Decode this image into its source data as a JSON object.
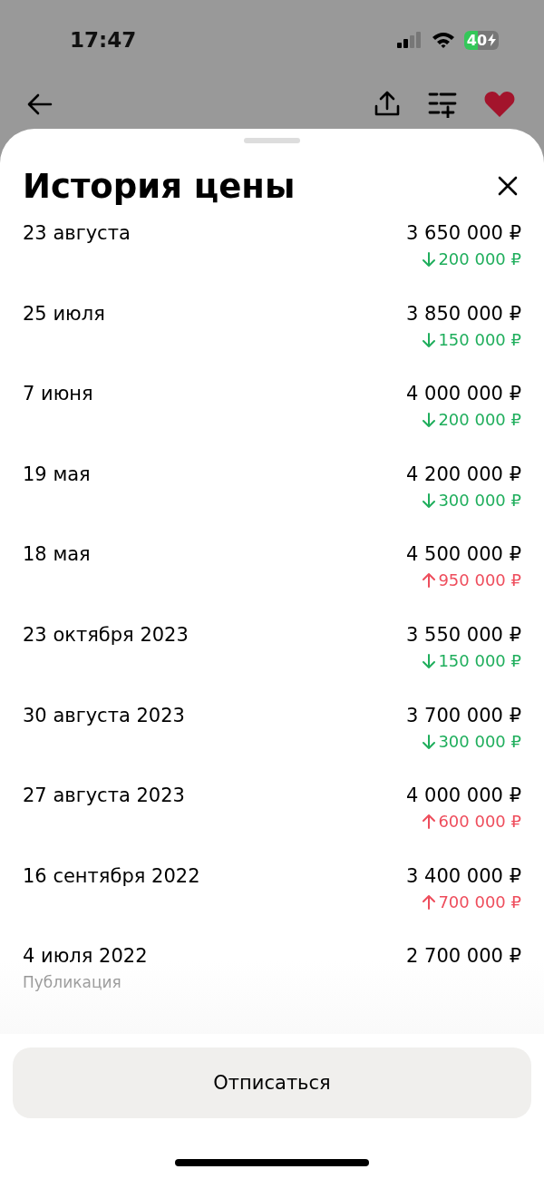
{
  "status_bar": {
    "time": "17:47",
    "battery": "40",
    "charging": true
  },
  "sheet": {
    "title": "История цены"
  },
  "history": [
    {
      "date": "23 августа",
      "price": "3 650 000 ₽",
      "change": {
        "kind": "down",
        "amount": "200 000 ₽"
      }
    },
    {
      "date": "25 июля",
      "price": "3 850 000 ₽",
      "change": {
        "kind": "down",
        "amount": "150 000 ₽"
      }
    },
    {
      "date": "7 июня",
      "price": "4 000 000 ₽",
      "change": {
        "kind": "down",
        "amount": "200 000 ₽"
      }
    },
    {
      "date": "19 мая",
      "price": "4 200 000 ₽",
      "change": {
        "kind": "down",
        "amount": "300 000 ₽"
      }
    },
    {
      "date": "18 мая",
      "price": "4 500 000 ₽",
      "change": {
        "kind": "up",
        "amount": "950 000 ₽"
      }
    },
    {
      "date": "23 октября 2023",
      "price": "3 550 000 ₽",
      "change": {
        "kind": "down",
        "amount": "150 000 ₽"
      }
    },
    {
      "date": "30 августа 2023",
      "price": "3 700 000 ₽",
      "change": {
        "kind": "down",
        "amount": "300 000 ₽"
      }
    },
    {
      "date": "27 августа 2023",
      "price": "4 000 000 ₽",
      "change": {
        "kind": "up",
        "amount": "600 000 ₽"
      }
    },
    {
      "date": "16 сентября 2022",
      "price": "3 400 000 ₽",
      "change": {
        "kind": "up",
        "amount": "700 000 ₽"
      }
    },
    {
      "date": "4 июля 2022",
      "price": "2 700 000 ₽",
      "note": "Публикация"
    }
  ],
  "footer": {
    "button": "Отписаться"
  }
}
